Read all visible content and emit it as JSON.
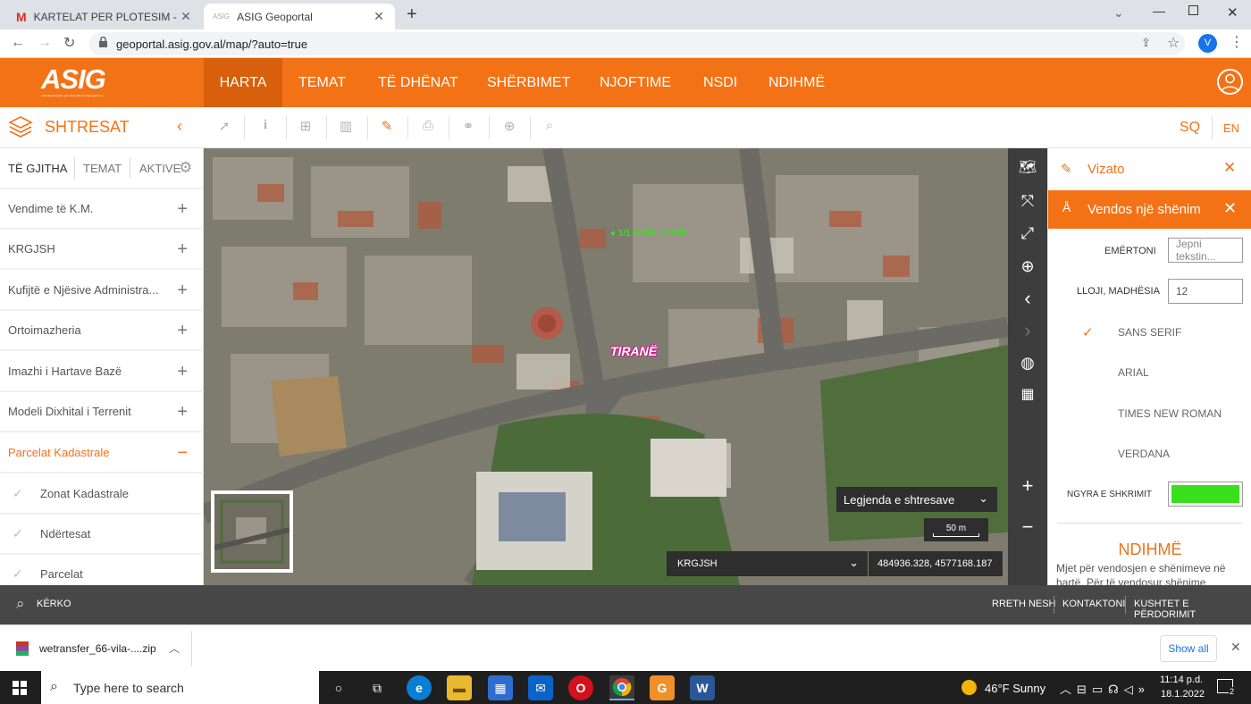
{
  "browser": {
    "tabs": [
      {
        "icon": "gmail-icon",
        "title": "KARTELAT PER PLOTESIM - vvorfë"
      },
      {
        "icon": "asig-favicon",
        "title": "ASIG Geoportal"
      }
    ],
    "new_tab": "+",
    "url": "geoportal.asig.gov.al/map/?auto=true",
    "profile_initial": "V"
  },
  "header": {
    "logo": "ASIG",
    "logo_subtitle": "Autoriteti Shtetëror për Informacionin Gjeohapësinor",
    "nav": [
      {
        "label": "HARTA",
        "active": true
      },
      {
        "label": "TEMAT"
      },
      {
        "label": "TË DHËNAT"
      },
      {
        "label": "SHËRBIMET"
      },
      {
        "label": "NJOFTIME"
      },
      {
        "label": "NSDI"
      },
      {
        "label": "NDIHMË"
      }
    ]
  },
  "toolbar": {
    "panel_title": "SHTRESAT",
    "lang_sq": "SQ",
    "lang_en": "EN"
  },
  "sidebar": {
    "tabs": [
      "TË GJITHA",
      "TEMAT",
      "AKTIVE"
    ],
    "layers": [
      {
        "label": "Vendime të K.M.",
        "toggle": "+"
      },
      {
        "label": "KRGJSH",
        "toggle": "+"
      },
      {
        "label": "Kufijtë e Njësive Administra...",
        "toggle": "+"
      },
      {
        "label": "Ortoimazheria",
        "toggle": "+"
      },
      {
        "label": "Imazhi i Hartave Bazë",
        "toggle": "+"
      },
      {
        "label": "Modeli Dixhital i Terrenit",
        "toggle": "+"
      },
      {
        "label": "Parcelat Kadastrale",
        "toggle": "−",
        "expanded": true
      }
    ],
    "sublayers": [
      "Zonat Kadastrale",
      "Ndërtesat",
      "Parcelat"
    ]
  },
  "map": {
    "city_label": "TIRANË",
    "green_label": "● 1/1 ATSH 1/1/7/8",
    "legend_button": "Legjenda e shtresave",
    "scale": "50 m",
    "crs": "KRGJSH",
    "coordinates": "484936.328, 4577168.187"
  },
  "draw_panel": {
    "title": "Vizato",
    "subtitle": "Vendos një shënim",
    "label_name": "EMËRTONI",
    "name_placeholder": "Jepni tekstin...",
    "label_type": "LLOJI, MADHËSIA",
    "size_value": "12",
    "fonts": [
      "SANS SERIF",
      "ARIAL",
      "TIMES NEW ROMAN",
      "VERDANA"
    ],
    "selected_font": "SANS SERIF",
    "label_color": "NGYRA E SHKRIMIT",
    "text_color": "#37e01a",
    "help_title": "NDIHMË",
    "help_text": "Mjet për vendosjen e shënimeve në hartë. Për të vendosur shënime"
  },
  "footer": {
    "search": "KËRKO",
    "links": [
      "RRETH NESH",
      "KONTAKTONI",
      "KUSHTET E PËRDORIMIT"
    ]
  },
  "downloads": {
    "file": "wetransfer_66-vila-....zip",
    "show_all": "Show all"
  },
  "taskbar": {
    "search_placeholder": "Type here to search",
    "weather": "46°F  Sunny",
    "time": "11:14 p.d.",
    "date": "18.1.2022",
    "notifications": "2"
  },
  "colors": {
    "brand": "#f47216",
    "brand_dark": "#d85f0c"
  }
}
